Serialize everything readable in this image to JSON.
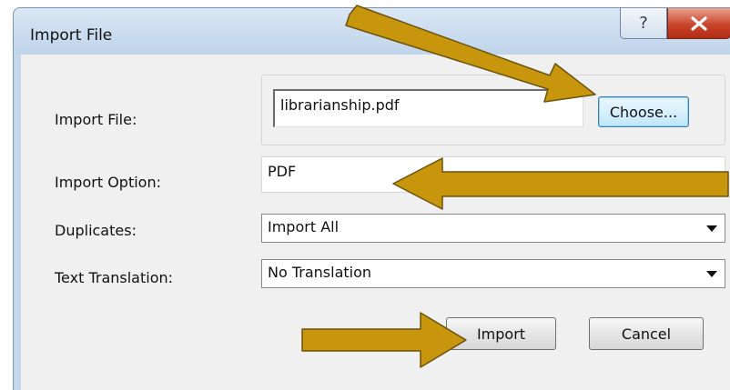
{
  "window": {
    "title": "Import File",
    "help_symbol": "?",
    "close_symbol": "X"
  },
  "form": {
    "import_file": {
      "label": "Import File:",
      "value": "librarianship.pdf",
      "choose_label": "Choose..."
    },
    "import_option": {
      "label": "Import Option:",
      "value": "PDF"
    },
    "duplicates": {
      "label": "Duplicates:",
      "selected": "Import All"
    },
    "text_translation": {
      "label": "Text Translation:",
      "selected": "No Translation"
    }
  },
  "buttons": {
    "import_label": "Import",
    "cancel_label": "Cancel"
  },
  "colors": {
    "annotation_arrow": "#c8960c",
    "arrow_outline": "#6b5310"
  },
  "icons": {
    "help": "question-mark-icon",
    "close": "close-icon",
    "dropdown": "chevron-down-icon",
    "annotation": "pointer-arrow-icon"
  }
}
